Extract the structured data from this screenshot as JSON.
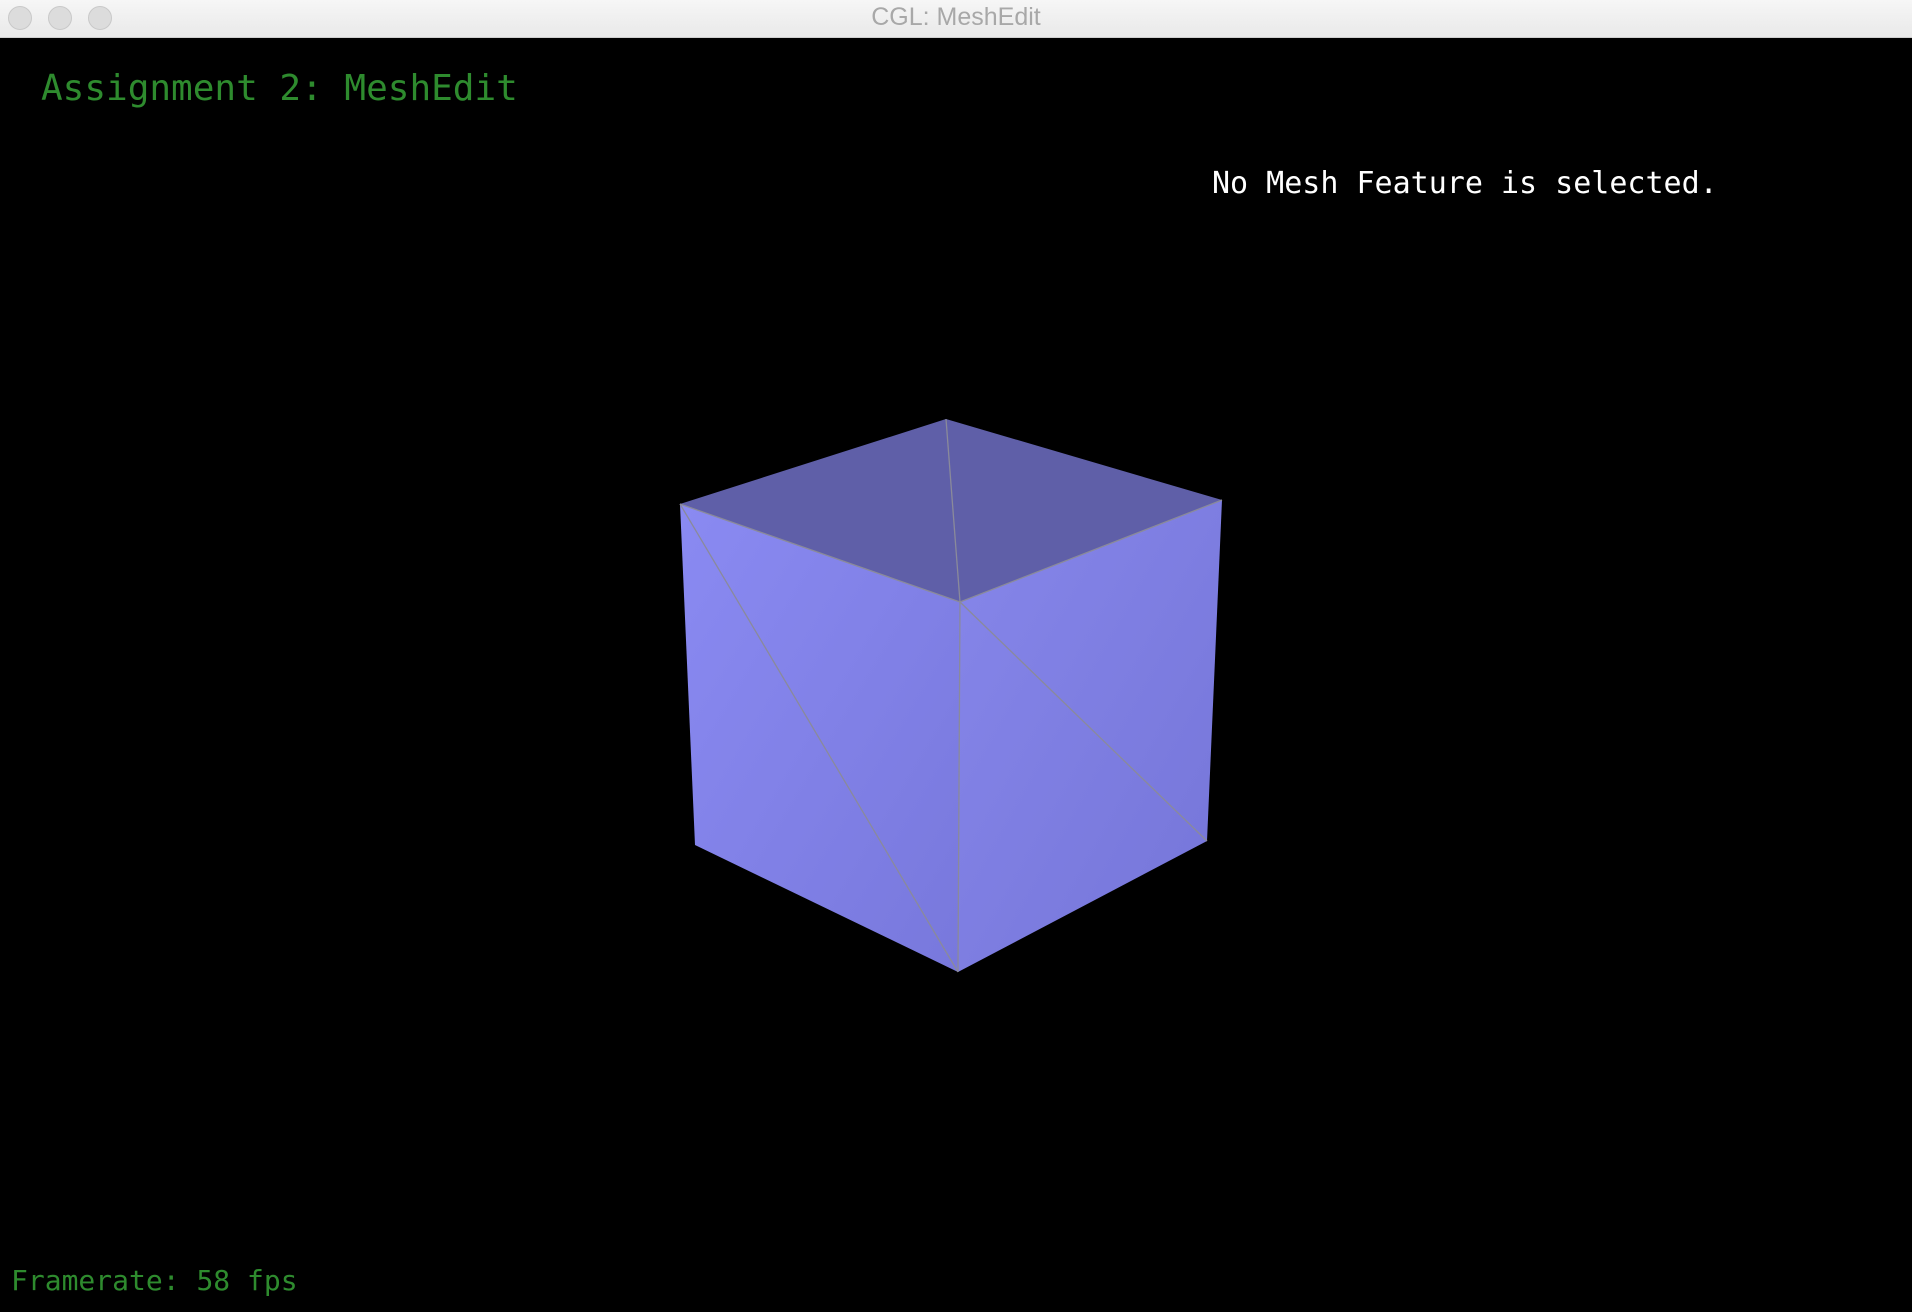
{
  "window": {
    "title": "CGL: MeshEdit"
  },
  "hud": {
    "assignment_title": "Assignment 2: MeshEdit",
    "selection_status": "No Mesh Feature is selected.",
    "framerate_label": "Framerate:",
    "framerate_value": "58 fps"
  },
  "scene": {
    "mesh": "cube",
    "colors": {
      "top_face": "#5f5fa8",
      "front_face": "#8585ee",
      "side_face": "#7b7be0",
      "edges": "#8a8a9a",
      "hud_green": "#2e8b2e",
      "hud_white": "#ffffff"
    }
  }
}
